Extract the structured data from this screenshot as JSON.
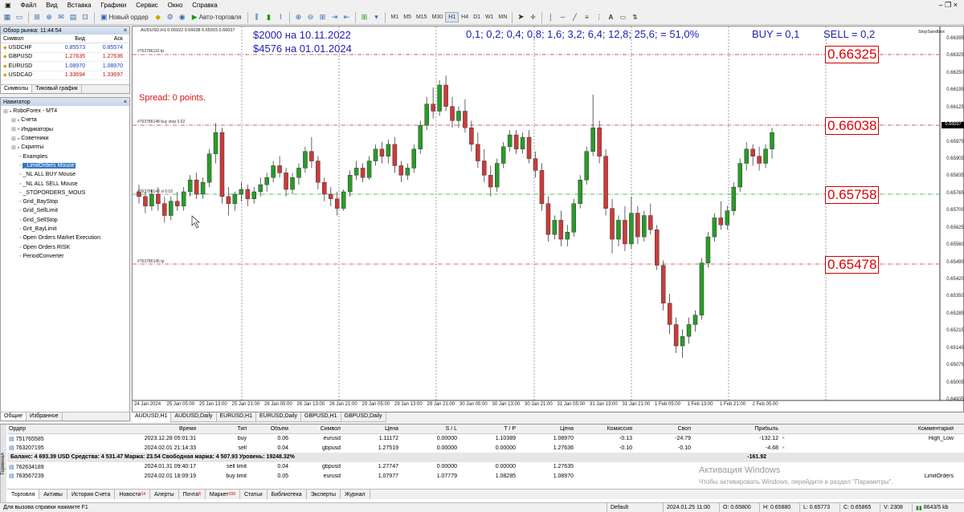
{
  "menu": [
    "Файл",
    "Вид",
    "Вставка",
    "Графики",
    "Сервис",
    "Окно",
    "Справка"
  ],
  "toolbar": {
    "new_order": "Новый ордер",
    "autotrade": "Авто-торговля",
    "timeframes": [
      "M1",
      "M5",
      "M15",
      "M30",
      "H1",
      "H4",
      "D1",
      "W1",
      "MN"
    ],
    "active_tf": "H1"
  },
  "market_watch": {
    "title": "Обзор рынка: 11:44:54",
    "headers": [
      "Символ",
      "Бид",
      "Аск"
    ],
    "rows": [
      {
        "symbol": "USDCHF",
        "bid": "0.85573",
        "ask": "0.85574",
        "color": "#1a3fbf"
      },
      {
        "symbol": "GBPUSD",
        "bid": "1.27635",
        "ask": "1.27636",
        "color": "#c01010"
      },
      {
        "symbol": "EURUSD",
        "bid": "1.08970",
        "ask": "1.08970",
        "color": "#1a3fbf"
      },
      {
        "symbol": "USDCAD",
        "bid": "1.33694",
        "ask": "1.33697",
        "color": "#c01010"
      }
    ],
    "tabs": [
      "Символы",
      "Тиковый график"
    ]
  },
  "navigator": {
    "title": "Навигатор",
    "items": [
      {
        "label": "RoboForex - MT4",
        "indent": 0
      },
      {
        "label": "Счета",
        "indent": 1
      },
      {
        "label": "Индикаторы",
        "indent": 1
      },
      {
        "label": "Советники",
        "indent": 1
      },
      {
        "label": "Скрипты",
        "indent": 1
      },
      {
        "label": "Examples",
        "indent": 2
      },
      {
        "label": "_LimitOrders Mouse",
        "indent": 2,
        "selected": true
      },
      {
        "label": "_NL ALL BUY Mouse",
        "indent": 2
      },
      {
        "label": "_NL ALL SELL Mouse",
        "indent": 2
      },
      {
        "label": "_STOPORDERS_MOUS",
        "indent": 2
      },
      {
        "label": "Grid_BayStop",
        "indent": 2
      },
      {
        "label": "Grid_SellLimit",
        "indent": 2
      },
      {
        "label": "Grid_SellStop",
        "indent": 2
      },
      {
        "label": "Grit_BayLimit",
        "indent": 2
      },
      {
        "label": "Open Orders Market Execution",
        "indent": 2
      },
      {
        "label": "Open Orders RISK",
        "indent": 2
      },
      {
        "label": "PeriodConverter",
        "indent": 2
      }
    ],
    "tabs": [
      "Общие",
      "Избранное"
    ]
  },
  "chart": {
    "caption": "AUDUSD,H1  0.65922 0.66038 0.65915 0.66037",
    "texts": {
      "t1": "$2000  на 10.11.2022",
      "t2": "$4576 на 01.01.2024",
      "t3": "0,1; 0,2; 0,4; 0,8; 1,6; 3,2; 6,4; 12,8; 25,6;  = 51,0%",
      "t4": "BUY = 0,1",
      "t5": "SELL = 0,2",
      "spread": "Spread: 0 points.",
      "brand": "StopSandbox"
    },
    "levels": [
      {
        "price": "0.66325",
        "label": "#763786110 tp"
      },
      {
        "price": "0.66038",
        "label": "#763786148 buy stop 0.02"
      },
      {
        "price": "0.65758",
        "label": "#763786148 sl 0.03"
      },
      {
        "price": "0.65478",
        "label": "#763786145 tp"
      }
    ],
    "current_price": "0.66037",
    "y_ticks": [
      "0.66395",
      "0.66325",
      "0.66250",
      "0.66195",
      "0.66125",
      "0.66050",
      "0.65975",
      "0.65905",
      "0.65835",
      "0.65765",
      "0.65700",
      "0.65625",
      "0.65560",
      "0.65490",
      "0.65420",
      "0.65350",
      "0.65285",
      "0.65215",
      "0.65145",
      "0.65075",
      "0.65005",
      "0.64935"
    ],
    "x_ticks": [
      "24 Jan 2024",
      "25 Jan 05:00",
      "25 Jan 13:00",
      "25 Jan 21:00",
      "26 Jan 05:00",
      "26 Jan 13:00",
      "26 Jan 21:00",
      "29 Jan 05:00",
      "29 Jan 13:00",
      "29 Jan 21:00",
      "30 Jan 05:00",
      "30 Jan 13:00",
      "30 Jan 21:00",
      "31 Jan 05:00",
      "31 Jan 13:00",
      "31 Jan 21:00",
      "1 Feb 05:00",
      "1 Feb 13:00",
      "1 Feb 21:00",
      "2 Feb 05:00"
    ],
    "tabs": [
      "AUDUSD,H1",
      "AUDUSD,Daily",
      "EURUSD,H1",
      "EURUSD,Daily",
      "GBPUSD,H1",
      "GBPUSD,Daily"
    ]
  },
  "chart_data": {
    "type": "candlestick",
    "symbol": "AUDUSD",
    "timeframe": "H1",
    "ylim": [
      0.649,
      0.6645
    ],
    "candles": [
      [
        0.6578,
        0.6581,
        0.6573,
        0.6576
      ],
      [
        0.6576,
        0.6578,
        0.6569,
        0.6572
      ],
      [
        0.6572,
        0.6579,
        0.657,
        0.6577
      ],
      [
        0.6577,
        0.658,
        0.657,
        0.6573
      ],
      [
        0.6573,
        0.6576,
        0.6565,
        0.6568
      ],
      [
        0.6568,
        0.6576,
        0.6566,
        0.6574
      ],
      [
        0.6574,
        0.6578,
        0.657,
        0.6572
      ],
      [
        0.6572,
        0.658,
        0.657,
        0.6578
      ],
      [
        0.6578,
        0.6585,
        0.6576,
        0.6583
      ],
      [
        0.6583,
        0.6586,
        0.6575,
        0.6577
      ],
      [
        0.6577,
        0.6584,
        0.6575,
        0.6582
      ],
      [
        0.6582,
        0.6596,
        0.658,
        0.6594
      ],
      [
        0.6594,
        0.6607,
        0.659,
        0.6603
      ],
      [
        0.6603,
        0.6605,
        0.6573,
        0.6576
      ],
      [
        0.6576,
        0.658,
        0.6568,
        0.6573
      ],
      [
        0.6573,
        0.6578,
        0.657,
        0.6577
      ],
      [
        0.6577,
        0.6582,
        0.6574,
        0.6579
      ],
      [
        0.6579,
        0.6581,
        0.6572,
        0.6575
      ],
      [
        0.6575,
        0.658,
        0.6573,
        0.6578
      ],
      [
        0.6578,
        0.6584,
        0.6576,
        0.6581
      ],
      [
        0.6581,
        0.6586,
        0.6578,
        0.6584
      ],
      [
        0.6584,
        0.6591,
        0.6582,
        0.6589
      ],
      [
        0.6589,
        0.6593,
        0.6584,
        0.6586
      ],
      [
        0.6586,
        0.6588,
        0.6576,
        0.6579
      ],
      [
        0.6579,
        0.6586,
        0.6577,
        0.6584
      ],
      [
        0.6584,
        0.659,
        0.6581,
        0.6588
      ],
      [
        0.6588,
        0.6597,
        0.6586,
        0.6595
      ],
      [
        0.6595,
        0.6601,
        0.6588,
        0.6591
      ],
      [
        0.6591,
        0.6593,
        0.6579,
        0.6582
      ],
      [
        0.6582,
        0.6584,
        0.6574,
        0.6577
      ],
      [
        0.6577,
        0.658,
        0.6572,
        0.6575
      ],
      [
        0.6575,
        0.6578,
        0.6568,
        0.6571
      ],
      [
        0.6571,
        0.6579,
        0.657,
        0.6578
      ],
      [
        0.6578,
        0.6587,
        0.6576,
        0.6585
      ],
      [
        0.6585,
        0.6591,
        0.6583,
        0.6588
      ],
      [
        0.6588,
        0.659,
        0.6582,
        0.6584
      ],
      [
        0.6584,
        0.6593,
        0.6583,
        0.6591
      ],
      [
        0.6591,
        0.6598,
        0.6589,
        0.6596
      ],
      [
        0.6596,
        0.6599,
        0.659,
        0.6593
      ],
      [
        0.6593,
        0.66,
        0.659,
        0.6598
      ],
      [
        0.6598,
        0.6601,
        0.6586,
        0.6589
      ],
      [
        0.6589,
        0.6591,
        0.6582,
        0.6585
      ],
      [
        0.6585,
        0.659,
        0.6583,
        0.6588
      ],
      [
        0.6588,
        0.6598,
        0.6586,
        0.6596
      ],
      [
        0.6596,
        0.6608,
        0.6594,
        0.6606
      ],
      [
        0.6606,
        0.6618,
        0.6604,
        0.6615
      ],
      [
        0.6615,
        0.6622,
        0.6609,
        0.6612
      ],
      [
        0.6612,
        0.6625,
        0.661,
        0.6623
      ],
      [
        0.6623,
        0.6627,
        0.6612,
        0.6614
      ],
      [
        0.6614,
        0.6618,
        0.6605,
        0.6608
      ],
      [
        0.6608,
        0.6614,
        0.6605,
        0.6612
      ],
      [
        0.6612,
        0.6617,
        0.6603,
        0.6605
      ],
      [
        0.6605,
        0.6608,
        0.6595,
        0.6598
      ],
      [
        0.6598,
        0.6603,
        0.6588,
        0.6591
      ],
      [
        0.6591,
        0.6596,
        0.6582,
        0.6585
      ],
      [
        0.6585,
        0.6589,
        0.6576,
        0.658
      ],
      [
        0.658,
        0.6592,
        0.6578,
        0.659
      ],
      [
        0.659,
        0.6599,
        0.6588,
        0.6597
      ],
      [
        0.6597,
        0.6604,
        0.6595,
        0.6602
      ],
      [
        0.6602,
        0.6604,
        0.6594,
        0.6596
      ],
      [
        0.6596,
        0.6603,
        0.6594,
        0.6601
      ],
      [
        0.6601,
        0.6604,
        0.659,
        0.6592
      ],
      [
        0.6592,
        0.6595,
        0.6584,
        0.6587
      ],
      [
        0.6587,
        0.659,
        0.657,
        0.6573
      ],
      [
        0.6573,
        0.6576,
        0.6557,
        0.656
      ],
      [
        0.656,
        0.6568,
        0.6558,
        0.6566
      ],
      [
        0.6566,
        0.657,
        0.6555,
        0.6558
      ],
      [
        0.6558,
        0.6564,
        0.6555,
        0.6561
      ],
      [
        0.6561,
        0.6575,
        0.6559,
        0.6573
      ],
      [
        0.6573,
        0.6585,
        0.6571,
        0.6583
      ],
      [
        0.6583,
        0.6597,
        0.6581,
        0.6595
      ],
      [
        0.6595,
        0.6619,
        0.6593,
        0.6605
      ],
      [
        0.6605,
        0.6608,
        0.659,
        0.6593
      ],
      [
        0.6593,
        0.6596,
        0.6568,
        0.6571
      ],
      [
        0.6571,
        0.6575,
        0.6552,
        0.6558
      ],
      [
        0.6558,
        0.6568,
        0.6555,
        0.6566
      ],
      [
        0.6566,
        0.6572,
        0.6553,
        0.6556
      ],
      [
        0.6556,
        0.6576,
        0.6554,
        0.6569
      ],
      [
        0.6569,
        0.6572,
        0.6556,
        0.6559
      ],
      [
        0.6559,
        0.657,
        0.6557,
        0.6568
      ],
      [
        0.6568,
        0.6573,
        0.656,
        0.6562
      ],
      [
        0.6562,
        0.6564,
        0.6545,
        0.6547
      ],
      [
        0.6547,
        0.6549,
        0.6528,
        0.6531
      ],
      [
        0.6531,
        0.6535,
        0.6518,
        0.6522
      ],
      [
        0.6522,
        0.6525,
        0.651,
        0.6513
      ],
      [
        0.6513,
        0.652,
        0.6508,
        0.6517
      ],
      [
        0.6517,
        0.6525,
        0.6514,
        0.6522
      ],
      [
        0.6522,
        0.6528,
        0.6519,
        0.6526
      ],
      [
        0.6526,
        0.655,
        0.6524,
        0.6548
      ],
      [
        0.6548,
        0.6561,
        0.6546,
        0.6559
      ],
      [
        0.6559,
        0.6569,
        0.6557,
        0.6567
      ],
      [
        0.6567,
        0.6574,
        0.6562,
        0.6564
      ],
      [
        0.6564,
        0.6572,
        0.6562,
        0.657
      ],
      [
        0.657,
        0.6582,
        0.6568,
        0.658
      ],
      [
        0.658,
        0.6592,
        0.6578,
        0.659
      ],
      [
        0.659,
        0.6599,
        0.6587,
        0.6596
      ],
      [
        0.6596,
        0.6598,
        0.6589,
        0.6593
      ],
      [
        0.6593,
        0.6597,
        0.6587,
        0.659
      ],
      [
        0.659,
        0.6598,
        0.6588,
        0.6596
      ],
      [
        0.6596,
        0.6605,
        0.6592,
        0.6603
      ]
    ]
  },
  "terminal": {
    "headers": [
      "Ордер",
      "Время",
      "Тип",
      "Объем",
      "Символ",
      "Цена",
      "S / L",
      "T / P",
      "Цена",
      "Комиссия",
      "Своп",
      "Прибыль",
      "",
      "Комментарий"
    ],
    "rows_top": [
      {
        "order": "751765585",
        "time": "2023.12.28 05:01:31",
        "type": "buy",
        "vol": "0.06",
        "sym": "eurusd",
        "price": "1.11172",
        "sl": "0.00000",
        "tp": "1.10389",
        "cur": "1.08970",
        "com": "-0.13",
        "swap": "-24.79",
        "profit": "-132.12",
        "comment": "High_Low"
      },
      {
        "order": "763207195",
        "time": "2024.02.01 21:14:33",
        "type": "sell",
        "vol": "0.04",
        "sym": "gbpusd",
        "price": "1.27519",
        "sl": "0.00000",
        "tp": "0.00000",
        "cur": "1.27636",
        "com": "-0.10",
        "swap": "-0.10",
        "profit": "-4.68",
        "comment": ""
      }
    ],
    "balance": "Баланс: 4 693.39 USD  Средства: 4 531.47  Маржа: 23.54  Свободная маржа: 4 507.93  Уровень: 19248.32%",
    "balance_profit": "-161.92",
    "rows_bottom": [
      {
        "order": "762634189",
        "time": "2024.01.31 09:40:17",
        "type": "sell limit",
        "vol": "0.04",
        "sym": "gbpusd",
        "price": "1.27747",
        "sl": "0.00000",
        "tp": "0.00000",
        "cur": "1.27635",
        "com": "",
        "swap": "",
        "profit": "",
        "comment": ""
      },
      {
        "order": "763567239",
        "time": "2024.02.01 18:09:19",
        "type": "buy limit",
        "vol": "0.05",
        "sym": "eurusd",
        "price": "1.07977",
        "sl": "1.07779",
        "tp": "1.08285",
        "cur": "1.08970",
        "com": "",
        "swap": "",
        "profit": "",
        "comment": "LimitOrders"
      }
    ],
    "tabs": [
      {
        "label": "Торговля"
      },
      {
        "label": "Активы"
      },
      {
        "label": "История Счета"
      },
      {
        "label": "Новости",
        "badge": "14"
      },
      {
        "label": "Алерты"
      },
      {
        "label": "Почта",
        "badge": "8"
      },
      {
        "label": "Маркет",
        "badge": "109"
      },
      {
        "label": "Статьи"
      },
      {
        "label": "Библиотека"
      },
      {
        "label": "Эксперты"
      },
      {
        "label": "Журнал"
      }
    ],
    "side_label": "Терминал"
  },
  "watermark": {
    "title": "Активация Windows",
    "sub": "Чтобы активировать Windows, перейдите в раздел \"Параметры\"."
  },
  "status": {
    "help": "Для вызова справки нажмите F1",
    "profile": "Default",
    "time": "2024.01.25 11:00",
    "open": "O: 0.65800",
    "high": "H: 0.65880",
    "low": "L: 0.65773",
    "close": "C: 0.65865",
    "vol": "V: 2308",
    "traffic": "8643/5 kb"
  }
}
